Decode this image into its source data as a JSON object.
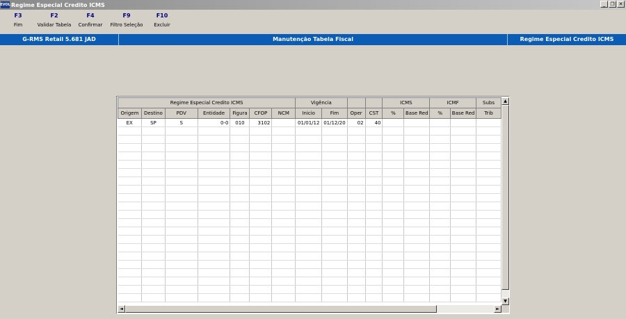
{
  "window": {
    "app_icon": "EVOL",
    "title": "Regime Especial Credito ICMS",
    "buttons": {
      "minimize": "_",
      "restore": "❐",
      "close": "✕"
    }
  },
  "toolbar": [
    {
      "key": "F3",
      "label": "Fim"
    },
    {
      "key": "F2",
      "label": "Validar Tabela"
    },
    {
      "key": "F4",
      "label": "Confirmar"
    },
    {
      "key": "F9",
      "label": "Filtro Seleção"
    },
    {
      "key": "F10",
      "label": "Excluir"
    }
  ],
  "statusbar": {
    "left": "G-RMS Retail 5.681 JAD",
    "center": "Manutenção Tabela Fiscal",
    "right": "Regime Especial Credito ICMS"
  },
  "grid": {
    "group_headers": [
      "Regime Especial Credito ICMS",
      "Vigência",
      "",
      "",
      "ICMS",
      "ICMF",
      "Subs"
    ],
    "columns": [
      "Origem",
      "Destino",
      "PDV",
      "Entidade",
      "Figura",
      "CFOP",
      "NCM",
      "Inicio",
      "Fim",
      "Oper",
      "CST",
      "%",
      "Base Red",
      "%",
      "Base Red",
      "Trib"
    ],
    "rows": [
      [
        "EX",
        "SP",
        "S",
        "0-0",
        "010",
        "3102",
        "",
        "01/01/12",
        "01/12/20",
        "02",
        "40",
        "",
        "",
        "",
        "",
        ""
      ]
    ],
    "scroll": {
      "up": "▲",
      "down": "▼",
      "left": "◄",
      "right": "►"
    }
  }
}
